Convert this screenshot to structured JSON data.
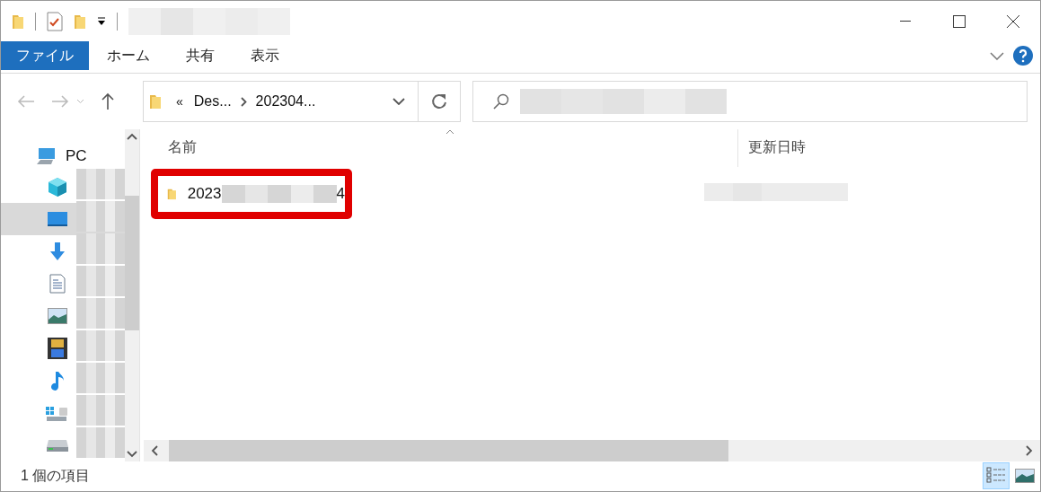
{
  "ribbon_tabs": [
    {
      "label": "ファイル",
      "kind": "file",
      "selected": false
    },
    {
      "label": "ホーム",
      "kind": "tab",
      "selected": false
    },
    {
      "label": "共有",
      "kind": "tab",
      "selected": false
    },
    {
      "label": "表示",
      "kind": "tab",
      "selected": false
    }
  ],
  "address_bar": {
    "overflow": "«",
    "segments": [
      "Des...",
      "202304..."
    ]
  },
  "sidebar": {
    "items": [
      {
        "label": "PC",
        "kind": "pc",
        "selected": false
      },
      {
        "kind": "cube",
        "selected": false
      },
      {
        "kind": "desktop",
        "selected": true
      },
      {
        "kind": "download",
        "selected": false
      },
      {
        "kind": "document",
        "selected": false
      },
      {
        "kind": "pictures",
        "selected": false
      },
      {
        "kind": "video",
        "selected": false
      },
      {
        "kind": "music",
        "selected": false
      },
      {
        "kind": "system-drive",
        "selected": false
      },
      {
        "kind": "drive",
        "selected": false
      }
    ]
  },
  "file_list": {
    "columns": [
      {
        "label": "名前",
        "sorted": true
      },
      {
        "label": "更新日時",
        "sorted": false
      }
    ],
    "rows": [
      {
        "name_start": "2023",
        "name_end": "4",
        "highlighted": true
      }
    ]
  },
  "status_bar": {
    "item_count": "1 個の項目",
    "views": [
      {
        "kind": "details",
        "selected": true
      },
      {
        "kind": "large-icons",
        "selected": false
      }
    ]
  }
}
